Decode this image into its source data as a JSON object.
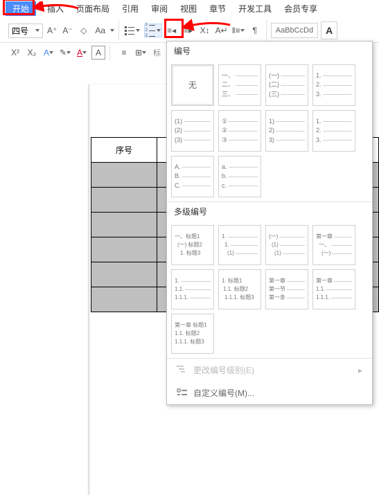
{
  "menu": {
    "start": "开始",
    "insert": "插入",
    "layout": "页面布局",
    "ref": "引用",
    "review": "审阅",
    "view": "视图",
    "chapter": "章节",
    "dev": "开发工具",
    "vip": "会员专享"
  },
  "toolbar": {
    "font_size": "四号",
    "Aplus": "A⁺",
    "Aminus": "A⁻",
    "style_sample": "AaBbCcDd",
    "style_label": "标"
  },
  "doc": {
    "col_a": "序号"
  },
  "dropdown": {
    "header1": "编号",
    "header2": "多级编号",
    "none": "无",
    "opt_cn": {
      "1": "一、",
      "2": "二、",
      "3": "三、"
    },
    "opt_paren_cn": {
      "1": "(一)",
      "2": "(二)",
      "3": "(三)"
    },
    "opt_dec_dot": {
      "1": "1.",
      "2": "2.",
      "3": "3."
    },
    "opt_paren_dec": {
      "1": "(1)",
      "2": "(2)",
      "3": "(3)"
    },
    "opt_circled": {
      "1": "①",
      "2": "②",
      "3": "③"
    },
    "opt_paren_dec2": {
      "1": "1)",
      "2": "2)",
      "3": "3)"
    },
    "opt_upper": {
      "1": "A.",
      "2": "B.",
      "3": "C."
    },
    "opt_lower": {
      "1": "a.",
      "2": "b.",
      "3": "c."
    },
    "m1": {
      "1": "一、标题1",
      "2": "(一) 标题2",
      "3": "1. 标题3"
    },
    "m2": {
      "1": "1.",
      "2": "1.",
      "3": "(1)"
    },
    "m3": {
      "1": "(一)",
      "2": "(1)",
      "3": "(1)"
    },
    "m4": {
      "1": "第一章",
      "2": "一、",
      "3": "(一)"
    },
    "m5": {
      "1": "1.",
      "2": "1.1.",
      "3": "1.1.1."
    },
    "m6": {
      "1": "1. 标题1",
      "2": "1.1. 标题2",
      "3": "1.1.1. 标题3"
    },
    "m7": {
      "1": "第一章",
      "2": "第一节",
      "3": "第一条"
    },
    "m8": {
      "1": "第一章",
      "2": "1.1.",
      "3": "1.1.1."
    },
    "m9": {
      "1": "第一章 标题1",
      "2": "1.1. 标题2",
      "3": "1.1.1. 标题3"
    },
    "change_level": "更改编号级别(E)",
    "custom": "自定义编号(M)..."
  }
}
